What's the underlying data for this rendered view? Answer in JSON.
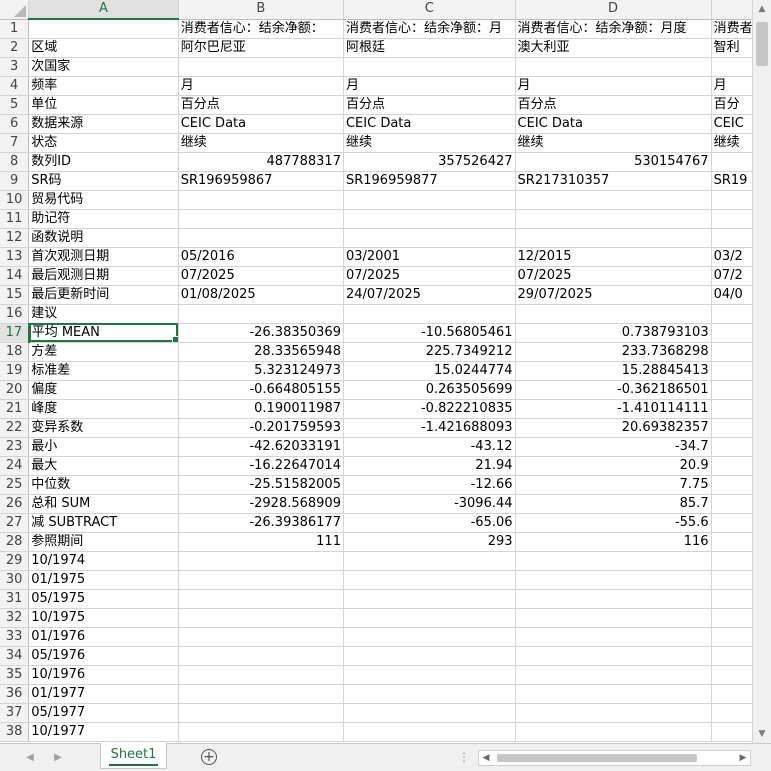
{
  "columns": [
    "A",
    "B",
    "C",
    "D",
    ""
  ],
  "selected_cell": {
    "row": 17,
    "col": "A"
  },
  "rows": [
    [
      "",
      "消费者信心：结余净额：",
      "消费者信心：结余净额：月",
      "消费者信心：结余净额：月度",
      "消费者"
    ],
    [
      "区域",
      "阿尔巴尼亚",
      "阿根廷",
      "澳大利亚",
      "智利"
    ],
    [
      "次国家",
      "",
      "",
      "",
      ""
    ],
    [
      "频率",
      "月",
      "月",
      "月",
      "月"
    ],
    [
      "单位",
      "百分点",
      "百分点",
      "百分点",
      "百分"
    ],
    [
      "数据来源",
      "CEIC Data",
      "CEIC Data",
      "CEIC Data",
      "CEIC"
    ],
    [
      "状态",
      "继续",
      "继续",
      "继续",
      "继续"
    ],
    [
      "数列ID",
      "487788317",
      "357526427",
      "530154767",
      ""
    ],
    [
      "SR码",
      "SR196959867",
      "SR196959877",
      "SR217310357",
      "SR19"
    ],
    [
      "贸易代码",
      "",
      "",
      "",
      ""
    ],
    [
      "助记符",
      "",
      "",
      "",
      ""
    ],
    [
      "函数说明",
      "",
      "",
      "",
      ""
    ],
    [
      "首次观测日期",
      "05/2016",
      "03/2001",
      "12/2015",
      "03/2"
    ],
    [
      "最后观测日期",
      "07/2025",
      "07/2025",
      "07/2025",
      "07/2"
    ],
    [
      "最后更新时间",
      "01/08/2025",
      "24/07/2025",
      "29/07/2025",
      "04/0"
    ],
    [
      "建议",
      "",
      "",
      "",
      ""
    ],
    [
      "平均 MEAN",
      "-26.38350369",
      "-10.56805461",
      "0.738793103",
      ""
    ],
    [
      "方差",
      "28.33565948",
      "225.7349212",
      "233.7368298",
      ""
    ],
    [
      "标准差",
      "5.323124973",
      "15.0244774",
      "15.28845413",
      ""
    ],
    [
      "偏度",
      "-0.664805155",
      "0.263505699",
      "-0.362186501",
      ""
    ],
    [
      "峰度",
      "0.190011987",
      "-0.822210835",
      "-1.410114111",
      ""
    ],
    [
      "变异系数",
      "-0.201759593",
      "-1.421688093",
      "20.69382357",
      ""
    ],
    [
      "最小",
      "-42.62033191",
      "-43.12",
      "-34.7",
      ""
    ],
    [
      "最大",
      "-16.22647014",
      "21.94",
      "20.9",
      ""
    ],
    [
      "中位数",
      "-25.51582005",
      "-12.66",
      "7.75",
      ""
    ],
    [
      "总和 SUM",
      "-2928.568909",
      "-3096.44",
      "85.7",
      ""
    ],
    [
      "减 SUBTRACT",
      "-26.39386177",
      "-65.06",
      "-55.6",
      ""
    ],
    [
      "参照期间",
      "111",
      "293",
      "116",
      ""
    ],
    [
      "10/1974",
      "",
      "",
      "",
      ""
    ],
    [
      "01/1975",
      "",
      "",
      "",
      ""
    ],
    [
      "05/1975",
      "",
      "",
      "",
      ""
    ],
    [
      "10/1975",
      "",
      "",
      "",
      ""
    ],
    [
      "01/1976",
      "",
      "",
      "",
      ""
    ],
    [
      "05/1976",
      "",
      "",
      "",
      ""
    ],
    [
      "10/1976",
      "",
      "",
      "",
      ""
    ],
    [
      "01/1977",
      "",
      "",
      "",
      ""
    ],
    [
      "05/1977",
      "",
      "",
      "",
      ""
    ],
    [
      "10/1977",
      "",
      "",
      "",
      ""
    ]
  ],
  "numeric_rows": [
    8,
    17,
    18,
    19,
    20,
    21,
    22,
    23,
    24,
    25,
    26,
    27,
    28
  ],
  "sheet_tab": "Sheet1",
  "add_sheet_symbol": "+",
  "split_symbol": "⋮"
}
